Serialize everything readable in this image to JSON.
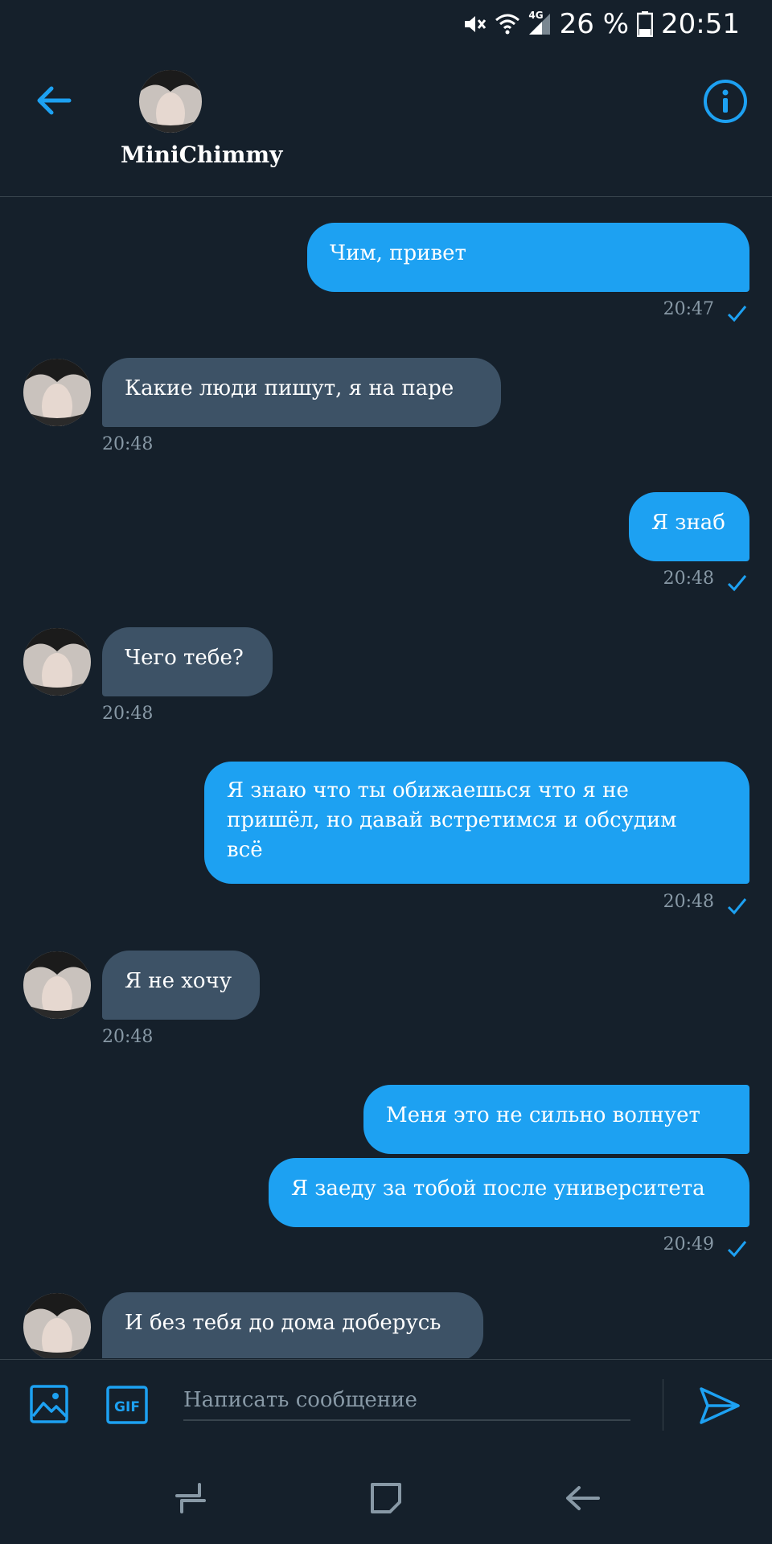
{
  "status_bar": {
    "battery_percent": "26 %",
    "time": "20:51",
    "network": "4G",
    "icons": [
      "mute-icon",
      "wifi-icon",
      "signal-icon",
      "battery-icon"
    ]
  },
  "header": {
    "contact_name": "MiniChimmy",
    "icons": [
      "back-arrow-icon",
      "avatar",
      "info-icon"
    ],
    "accent_color": "#1da1f2"
  },
  "messages": [
    {
      "direction": "out",
      "text": "Чим, привет",
      "time": "20:47",
      "read": true
    },
    {
      "direction": "in",
      "text": "Какие люди пишут, я на паре",
      "time": "20:48"
    },
    {
      "direction": "out",
      "text": "Я знаб",
      "time": "20:48",
      "read": true
    },
    {
      "direction": "in",
      "text": "Чего тебе?",
      "time": "20:48"
    },
    {
      "direction": "out",
      "text_lines": [
        "Я знаю что ты обижаешься что я не",
        "пришёл, но давай встретимся и обсудим",
        "всё"
      ],
      "time": "20:48",
      "read": true
    },
    {
      "direction": "in",
      "text": "Я не хочу",
      "time": "20:48"
    },
    {
      "direction": "out",
      "text": "Меня это не сильно волнует"
    },
    {
      "direction": "out",
      "text": "Я заеду за тобой после университета",
      "time": "20:49",
      "read": true
    },
    {
      "direction": "in",
      "text": "И без тебя до дома доберусь"
    }
  ],
  "composer": {
    "placeholder": "Написать сообщение",
    "gif_label": "GIF",
    "icons": [
      "image-icon",
      "gif-icon",
      "send-icon"
    ]
  },
  "nav_bar": {
    "icons": [
      "recent-apps-icon",
      "home-icon",
      "back-icon"
    ]
  },
  "colors": {
    "background": "#15202b",
    "outgoing_bubble": "#1da1f2",
    "incoming_bubble": "#3d5266",
    "timestamp": "#8899a6"
  }
}
